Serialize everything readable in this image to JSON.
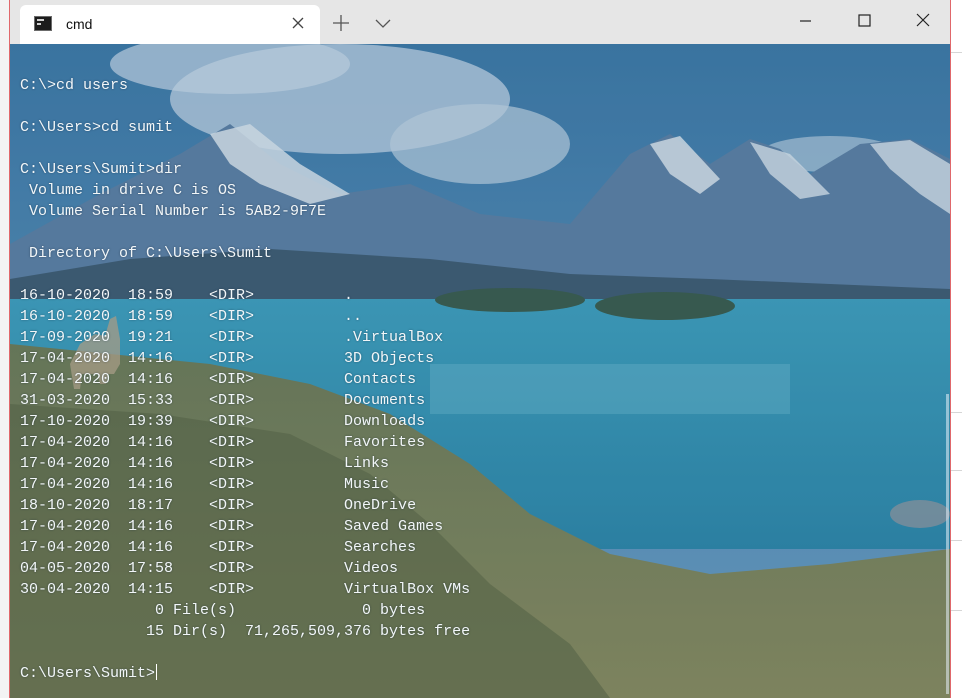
{
  "window": {
    "tab_title": "cmd",
    "new_tab_label": "+",
    "close_tab_label": "×"
  },
  "colors": {
    "titlebar": "#e6e6e6",
    "tab": "#ffffff",
    "window_border": "#e0676b",
    "terminal_text": "#f2f6f8"
  },
  "icons": [
    "cmd-icon",
    "close-icon",
    "plus-icon",
    "chevron-down-icon",
    "minimize-icon",
    "maximize-icon",
    "close-window-icon"
  ],
  "terminal": {
    "lines": [
      "C:\\>cd users",
      "",
      "C:\\Users>cd sumit",
      "",
      "C:\\Users\\Sumit>dir",
      " Volume in drive C is OS",
      " Volume Serial Number is 5AB2-9F7E",
      "",
      " Directory of C:\\Users\\Sumit",
      "",
      "16-10-2020  18:59    <DIR>          .",
      "16-10-2020  18:59    <DIR>          ..",
      "17-09-2020  19:21    <DIR>          .VirtualBox",
      "17-04-2020  14:16    <DIR>          3D Objects",
      "17-04-2020  14:16    <DIR>          Contacts",
      "31-03-2020  15:33    <DIR>          Documents",
      "17-10-2020  19:39    <DIR>          Downloads",
      "17-04-2020  14:16    <DIR>          Favorites",
      "17-04-2020  14:16    <DIR>          Links",
      "17-04-2020  14:16    <DIR>          Music",
      "18-10-2020  18:17    <DIR>          OneDrive",
      "17-04-2020  14:16    <DIR>          Saved Games",
      "17-04-2020  14:16    <DIR>          Searches",
      "04-05-2020  17:58    <DIR>          Videos",
      "30-04-2020  14:15    <DIR>          VirtualBox VMs",
      "               0 File(s)              0 bytes",
      "              15 Dir(s)  71,265,509,376 bytes free",
      ""
    ],
    "prompt": "C:\\Users\\Sumit>"
  }
}
